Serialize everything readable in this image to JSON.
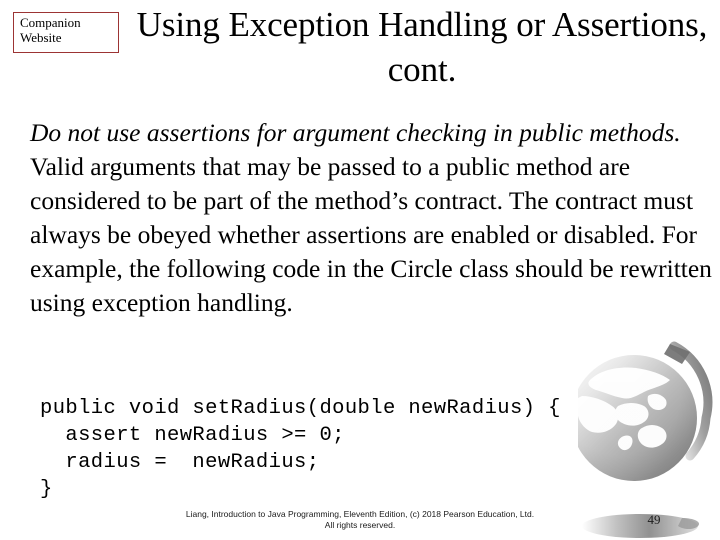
{
  "slide": {
    "badge": {
      "line1": "Companion",
      "line2": "Website",
      "border_color": "#9c3434"
    },
    "title": "Using Exception Handling or Assertions, cont.",
    "body": {
      "emphasis": "Do not use assertions for argument checking in public methods.",
      "rest": " Valid arguments that may be passed to a public method are considered to be part of the method’s contract. The contract must always be obeyed whether assertions are enabled or disabled. For example, the following code in the Circle class should be rewritten using exception handling."
    },
    "code": "public void setRadius(double newRadius) {\n  assert newRadius >= 0;\n  radius =  newRadius;\n}",
    "footer": {
      "line1": "Liang, Introduction to Java Programming, Eleventh Edition, (c) 2018 Pearson Education, Ltd.",
      "line2": "All rights reserved."
    },
    "page_number": "49",
    "decoration": {
      "icon": "globe-icon",
      "color": "#808080"
    }
  }
}
